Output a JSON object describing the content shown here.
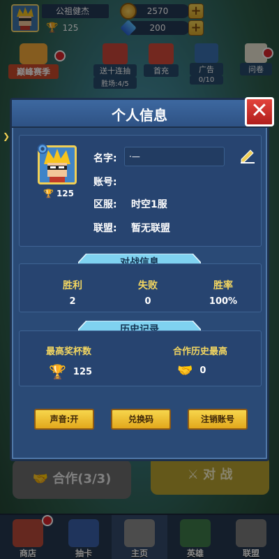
{
  "topbar": {
    "player_name": "公祖健杰",
    "trophies": "125",
    "coins": "2570",
    "gems": "200",
    "plus": "+"
  },
  "events": {
    "items": [
      {
        "label": "巅峰赛季"
      },
      {
        "label": "送十连抽",
        "sub": "胜场:4/5"
      },
      {
        "label": "首充"
      },
      {
        "label": "广告",
        "sub": "0/10"
      },
      {
        "label": "问卷"
      }
    ]
  },
  "modes": {
    "coop": "合作(3/3)",
    "battle": "对 战"
  },
  "tabs": [
    {
      "label": "商店"
    },
    {
      "label": "抽卡"
    },
    {
      "label": "主页"
    },
    {
      "label": "英雄"
    },
    {
      "label": "联盟"
    }
  ],
  "dialog": {
    "title": "个人信息",
    "close": "✕",
    "profile": {
      "trophies": "125",
      "name_label": "名字:",
      "name_value": "·—",
      "account_label": "账号:",
      "account_value": "",
      "server_label": "区服:",
      "server_value": "时空1服",
      "alliance_label": "联盟:",
      "alliance_value": "暂无联盟"
    },
    "battle_section": {
      "title": "对战信息",
      "headers": [
        "胜利",
        "失败",
        "胜率"
      ],
      "values": [
        "2",
        "0",
        "100%"
      ]
    },
    "history_section": {
      "title": "历史记录",
      "best_trophy_label": "最高奖杯数",
      "best_trophy_value": "125",
      "best_coop_label": "合作历史最高",
      "best_coop_value": "0"
    },
    "buttons": {
      "sound": "声音:开",
      "redeem": "兑换码",
      "logout": "注销账号"
    }
  },
  "colors": {
    "accent_gold": "#f2d054",
    "panel_blue": "#2a4a76",
    "close_red": "#d8262c"
  }
}
